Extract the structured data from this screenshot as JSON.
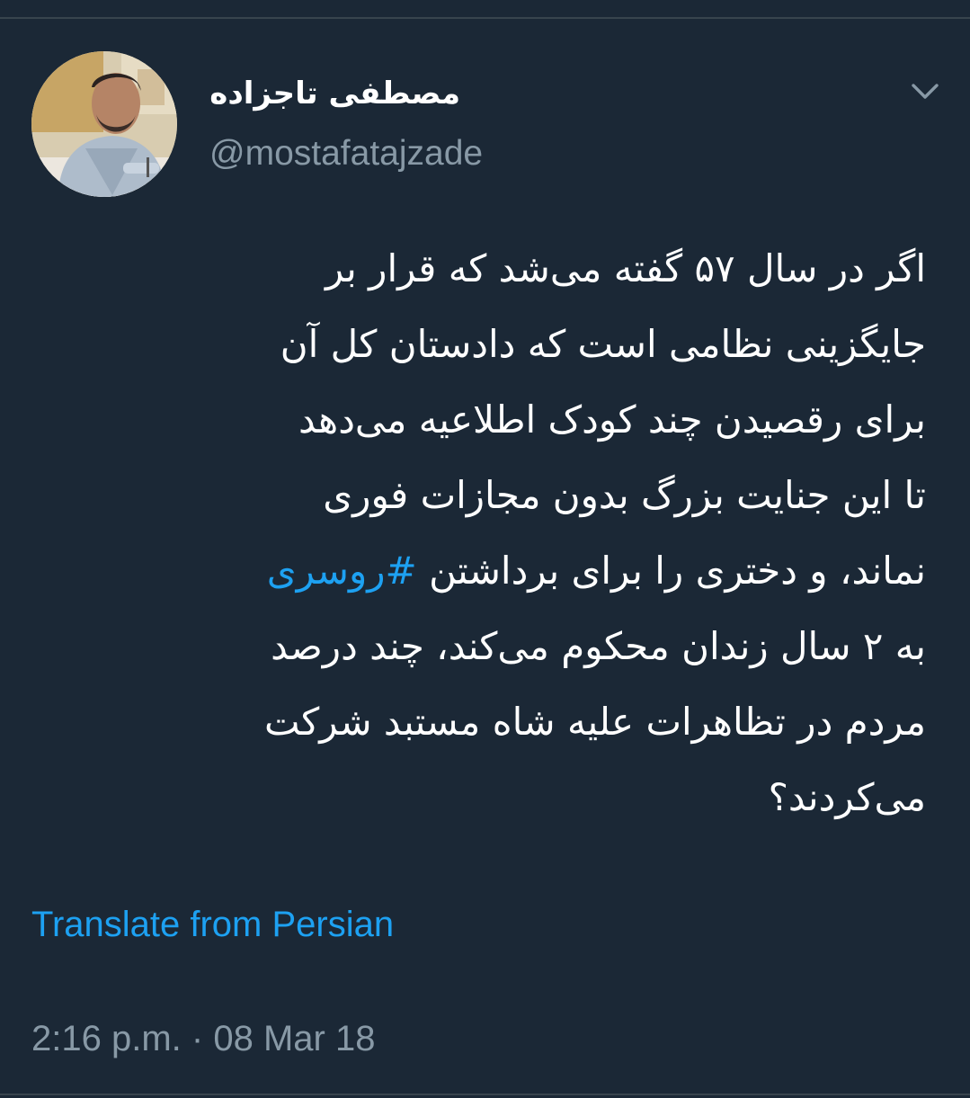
{
  "author": {
    "display_name": "مصطفی تاجزاده",
    "handle": "@mostafatajzade",
    "avatar_icon": "profile-photo"
  },
  "menu_icon": "chevron-down-icon",
  "tweet": {
    "lines": [
      {
        "text": "اگر در سال ۵۷ گفته می‌شد که قرار بر"
      },
      {
        "text": "جایگزینی نظامی است که دادستان کل آن"
      },
      {
        "text": "برای رقصیدن چند کودک اطلاعیه می‌دهد"
      },
      {
        "text": "تا این جنایت بزرگ بدون مجازات فوری"
      },
      {
        "text": "نماند، و دختری را برای برداشتن ",
        "hashtag": "#روسری"
      },
      {
        "text": "به ۲ سال زندان محکوم می‌کند، چند درصد"
      },
      {
        "text": "مردم در تظاهرات علیه شاه مستبد شرکت"
      },
      {
        "text": "می‌کردند؟"
      }
    ]
  },
  "translate_label": "Translate from Persian",
  "timestamp": {
    "time": "2:16 p.m.",
    "separator": "·",
    "date": "08 Mar 18"
  },
  "colors": {
    "background": "#1b2836",
    "text": "#ffffff",
    "secondary": "#8899a6",
    "accent": "#1da1f2"
  }
}
